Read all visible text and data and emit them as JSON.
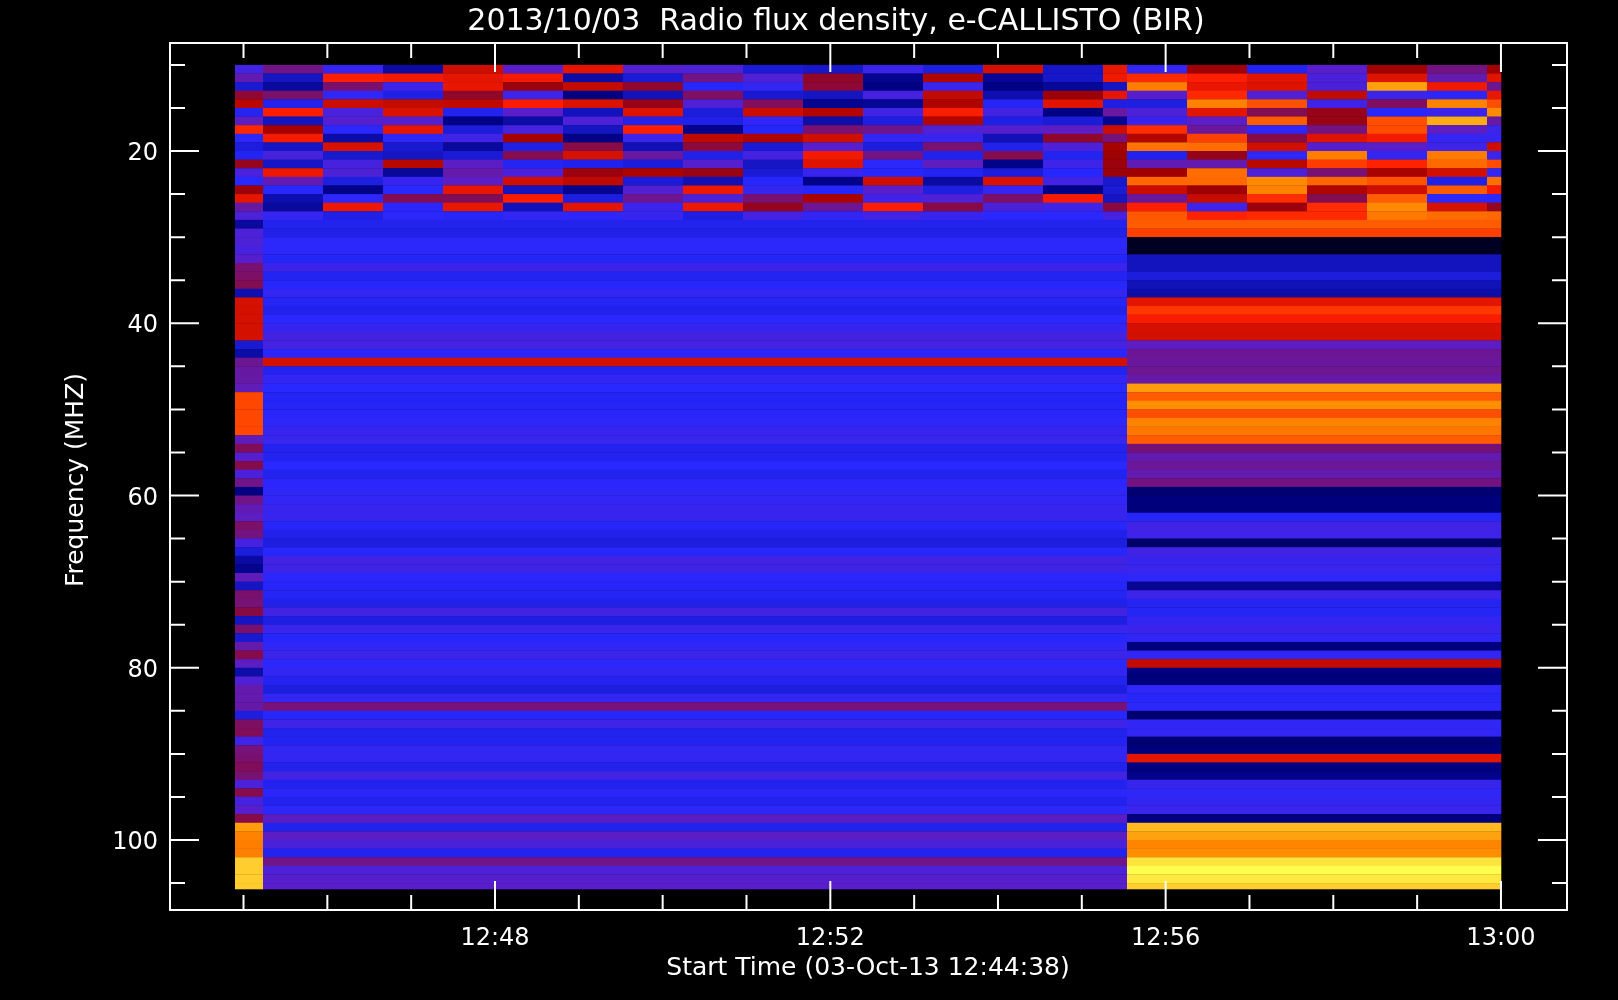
{
  "title": "2013/10/03  Radio flux density, e-CALLISTO (BIR)",
  "y_axis": {
    "label": "Frequency (MHZ)",
    "ticks": [
      "20",
      "40",
      "60",
      "80",
      "100"
    ]
  },
  "x_axis": {
    "label": "Start Time (03-Oct-13 12:44:38)",
    "ticks": [
      "12:48",
      "12:52",
      "12:56",
      "13:00"
    ]
  }
}
